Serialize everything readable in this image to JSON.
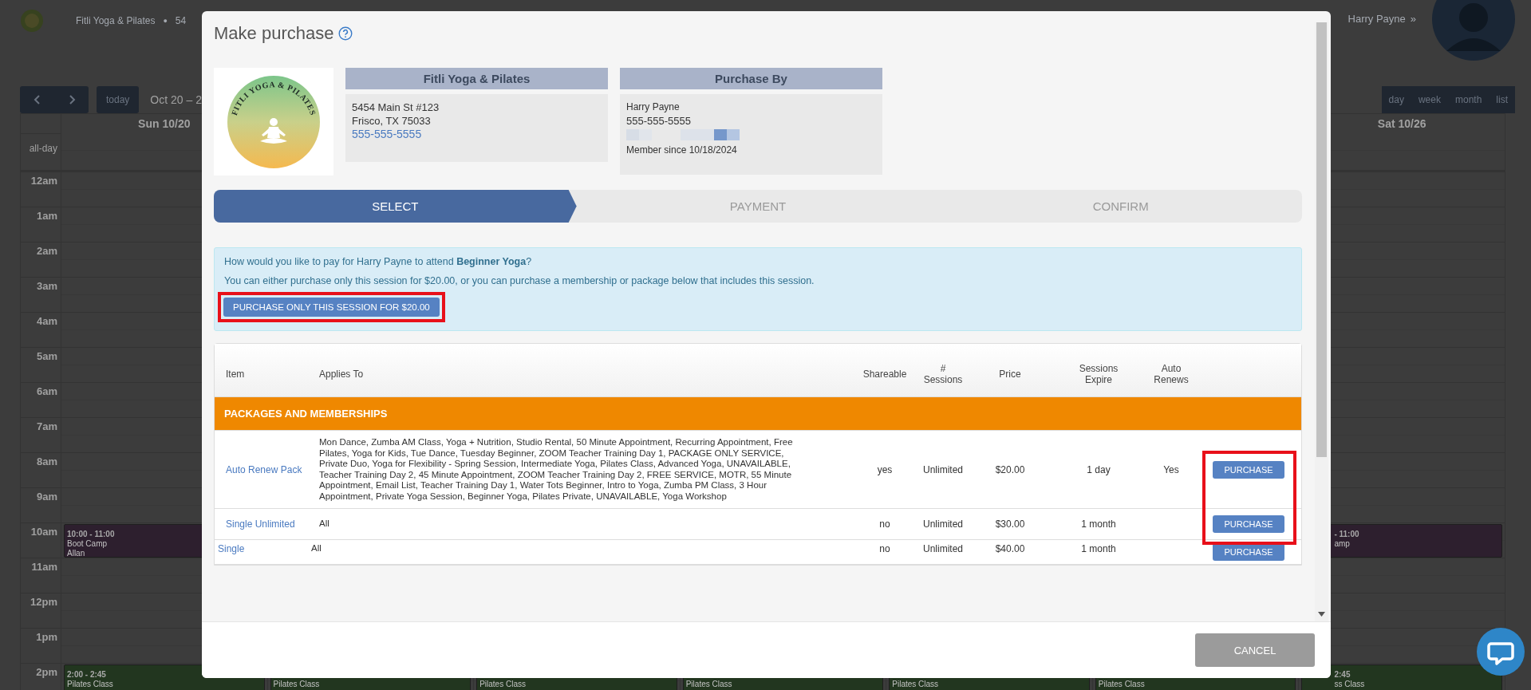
{
  "background": {
    "header": {
      "brand": "Fitli Yoga & Pilates",
      "separator": "●",
      "address": "54",
      "user": "Harry Payne",
      "user_menu": "»"
    },
    "toolbar": {
      "today": "today",
      "range": "Oct 20 – 2",
      "views": [
        "day",
        "week",
        "month",
        "list"
      ]
    },
    "calendar": {
      "day_headers": [
        "Sun 10/20",
        "Sat 10/26"
      ],
      "all_day": "all-day",
      "hours": [
        {
          "label": "12am"
        },
        {
          "label": "1am"
        },
        {
          "label": "2am"
        },
        {
          "label": "3am"
        },
        {
          "label": "4am"
        },
        {
          "label": "5am"
        },
        {
          "label": "6am"
        },
        {
          "label": "7am"
        },
        {
          "label": "8am"
        },
        {
          "label": "9am"
        },
        {
          "label": "10am",
          "sun": {
            "time": "10:00 - 11:00",
            "title": "Boot Camp",
            "note": "Allan",
            "color": "#2d1f2e"
          },
          "sat": {
            "time": "- 11:00",
            "title": "amp",
            "color": "#2d1f2e"
          }
        },
        {
          "label": "11am"
        },
        {
          "label": "12pm"
        },
        {
          "label": "1pm"
        },
        {
          "label": "2pm",
          "sun": {
            "time": "2:00 - 2:45",
            "title": "Pilates Class",
            "color": "#22361f"
          },
          "mon": {
            "title": "Pilates Class",
            "color": "#22361f"
          },
          "tue": {
            "title": "Pilates Class",
            "color": "#22361f"
          },
          "wed": {
            "title": "Pilates Class",
            "color": "#22361f"
          },
          "thu": {
            "title": "Pilates Class",
            "color": "#22361f"
          },
          "fri": {
            "title": "Pilates Class",
            "color": "#22361f"
          },
          "sat": {
            "time": "2:45",
            "title": "ss Class",
            "color": "#22361f"
          }
        }
      ]
    }
  },
  "modal": {
    "title": "Make purchase",
    "logo_text": "FITLI YOGA & PILATES",
    "studio": {
      "heading": "Fitli Yoga & Pilates",
      "address_lines": [
        "5454 Main St #123",
        "Frisco, TX 75033"
      ],
      "phone": "555-555-5555"
    },
    "purchaser": {
      "heading": "Purchase By",
      "name": "Harry Payne",
      "phone": "555-555-5555",
      "member_since": "Member since 10/18/2024"
    },
    "steps": [
      {
        "label": "SELECT",
        "selected": true
      },
      {
        "label": "PAYMENT",
        "selected": false
      },
      {
        "label": "CONFIRM",
        "selected": false
      }
    ],
    "prompt": "How would you like to pay for Harry Payne to attend **Beginner Yoga**?",
    "note": "You can either purchase only this session for $20.00, or you can purchase a membership or package below that includes this session.",
    "session_button": {
      "label": "PURCHASE ONLY THIS SESSION FOR $20.00",
      "highlighted": true
    },
    "table": {
      "columns": [
        [
          "Item"
        ],
        [
          "Applies To"
        ],
        [
          "Shareable"
        ],
        [
          "#",
          "Sessions"
        ],
        [
          "Price"
        ],
        [
          "Sessions",
          "Expire"
        ],
        [
          "Auto",
          "Renews"
        ]
      ],
      "section": "PACKAGES AND MEMBERSHIPS",
      "rows": [
        {
          "item": "Auto Renew Pack",
          "applies_to": "Mon Dance, Zumba AM Class, Yoga + Nutrition, Studio Rental, 50 Minute Appointment, Recurring Appointment, Free Pilates, Yoga for Kids, Tue Dance, Tuesday Beginner, ZOOM Teacher Training Day 1, PACKAGE ONLY SERVICE, Private Duo, Yoga for Flexibility - Spring Session, Intermediate Yoga, Pilates Class, Advanced Yoga, UNAVAILABLE, Teacher Training Day 2, 45 Minute Appointment, ZOOM Teacher Training Day 2, FREE SERVICE, MOTR, 55 Minute Appointment, Email List, Teacher Training Day 1, Water Tots Beginner, Intro to Yoga, Zumba PM Class, 3 Hour Appointment, Private Yoga Session, Beginner Yoga, Pilates Private, UNAVAILABLE, Yoga Workshop",
          "shareable": "yes",
          "sessions": "Unlimited",
          "price": "$20.00",
          "expire": "1 day",
          "auto_renews": "Yes",
          "button": "PURCHASE",
          "highlighted": true
        },
        {
          "item": "Single Unlimited",
          "applies_to": "All",
          "shareable": "no",
          "sessions": "Unlimited",
          "price": "$30.00",
          "expire": "1 month",
          "button": "PURCHASE",
          "highlighted": true
        },
        {
          "item": "Single",
          "applies_to": "All",
          "shareable": "no",
          "sessions": "Unlimited",
          "price": "$40.00",
          "expire": "1 month",
          "button": "PURCHASE",
          "highlighted": false
        }
      ]
    },
    "cancel": "CANCEL"
  }
}
